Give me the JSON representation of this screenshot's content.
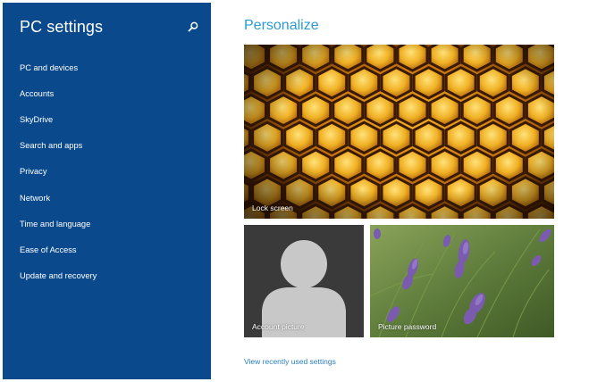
{
  "sidebar": {
    "title": "PC settings",
    "search_icon": "search-icon",
    "items": [
      {
        "label": "PC and devices"
      },
      {
        "label": "Accounts"
      },
      {
        "label": "SkyDrive"
      },
      {
        "label": "Search and apps"
      },
      {
        "label": "Privacy"
      },
      {
        "label": "Network"
      },
      {
        "label": "Time and language"
      },
      {
        "label": "Ease of Access"
      },
      {
        "label": "Update and recovery"
      }
    ]
  },
  "main": {
    "title": "Personalize",
    "tiles": {
      "lock_screen": "Lock screen",
      "account_picture": "Account picture",
      "picture_password": "Picture password"
    },
    "recent_link": "View recently used settings"
  },
  "colors": {
    "sidebar_bg": "#0a4a8c",
    "accent": "#2a9ad3",
    "link": "#2a7fc0"
  }
}
